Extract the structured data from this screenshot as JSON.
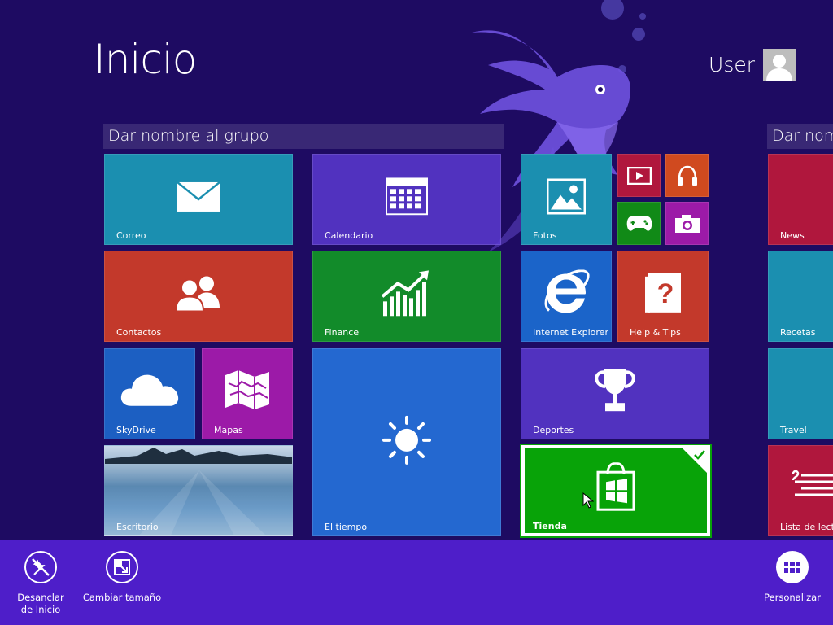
{
  "title": "Inicio",
  "user": {
    "name": "User"
  },
  "groups": [
    {
      "label": "Dar nombre al grupo"
    },
    {
      "label": "Dar nombre al grupo"
    }
  ],
  "tiles": {
    "correo": {
      "label": "Correo",
      "color": "#1b8fb0"
    },
    "calendario": {
      "label": "Calendario",
      "color": "#5b3ad0"
    },
    "fotos": {
      "label": "Fotos",
      "color": "#1b8fb0"
    },
    "video": {
      "label": "",
      "color": "#b0173d"
    },
    "musica": {
      "label": "",
      "color": "#d04a1f"
    },
    "juegos": {
      "label": "",
      "color": "#118a17"
    },
    "camara": {
      "label": "",
      "color": "#9c1aa8"
    },
    "contactos": {
      "label": "Contactos",
      "color": "#c3392b"
    },
    "finance": {
      "label": "Finance",
      "color": "#128b2a"
    },
    "internet_explorer": {
      "label": "Internet Explorer",
      "color": "#1b64c9"
    },
    "help_tips": {
      "label": "Help & Tips",
      "color": "#c3392b"
    },
    "skydrive": {
      "label": "SkyDrive",
      "color": "#1c5fc2"
    },
    "mapas": {
      "label": "Mapas",
      "color": "#9c1aa8"
    },
    "el_tiempo": {
      "label": "El tiempo",
      "color": "#2468d0"
    },
    "deportes": {
      "label": "Deportes",
      "color": "#5b3ad0"
    },
    "escritorio": {
      "label": "Escritorio",
      "color": "#3e74a8"
    },
    "tienda": {
      "label": "Tienda",
      "color": "#08a308"
    },
    "news": {
      "label": "News",
      "color": "#b0173d"
    },
    "recetas": {
      "label": "Recetas",
      "color": "#1b8fb0"
    },
    "travel": {
      "label": "Travel",
      "color": "#1b8fb0"
    },
    "lista_lectura": {
      "label": "Lista de lectura",
      "color": "#b0173d"
    }
  },
  "appbar": {
    "unpin": "Desanclar de Inicio",
    "resize": "Cambiar tamaño",
    "customize": "Personalizar"
  },
  "colors": {
    "background": "#1e0b62",
    "appbar": "#4e1ec9"
  }
}
